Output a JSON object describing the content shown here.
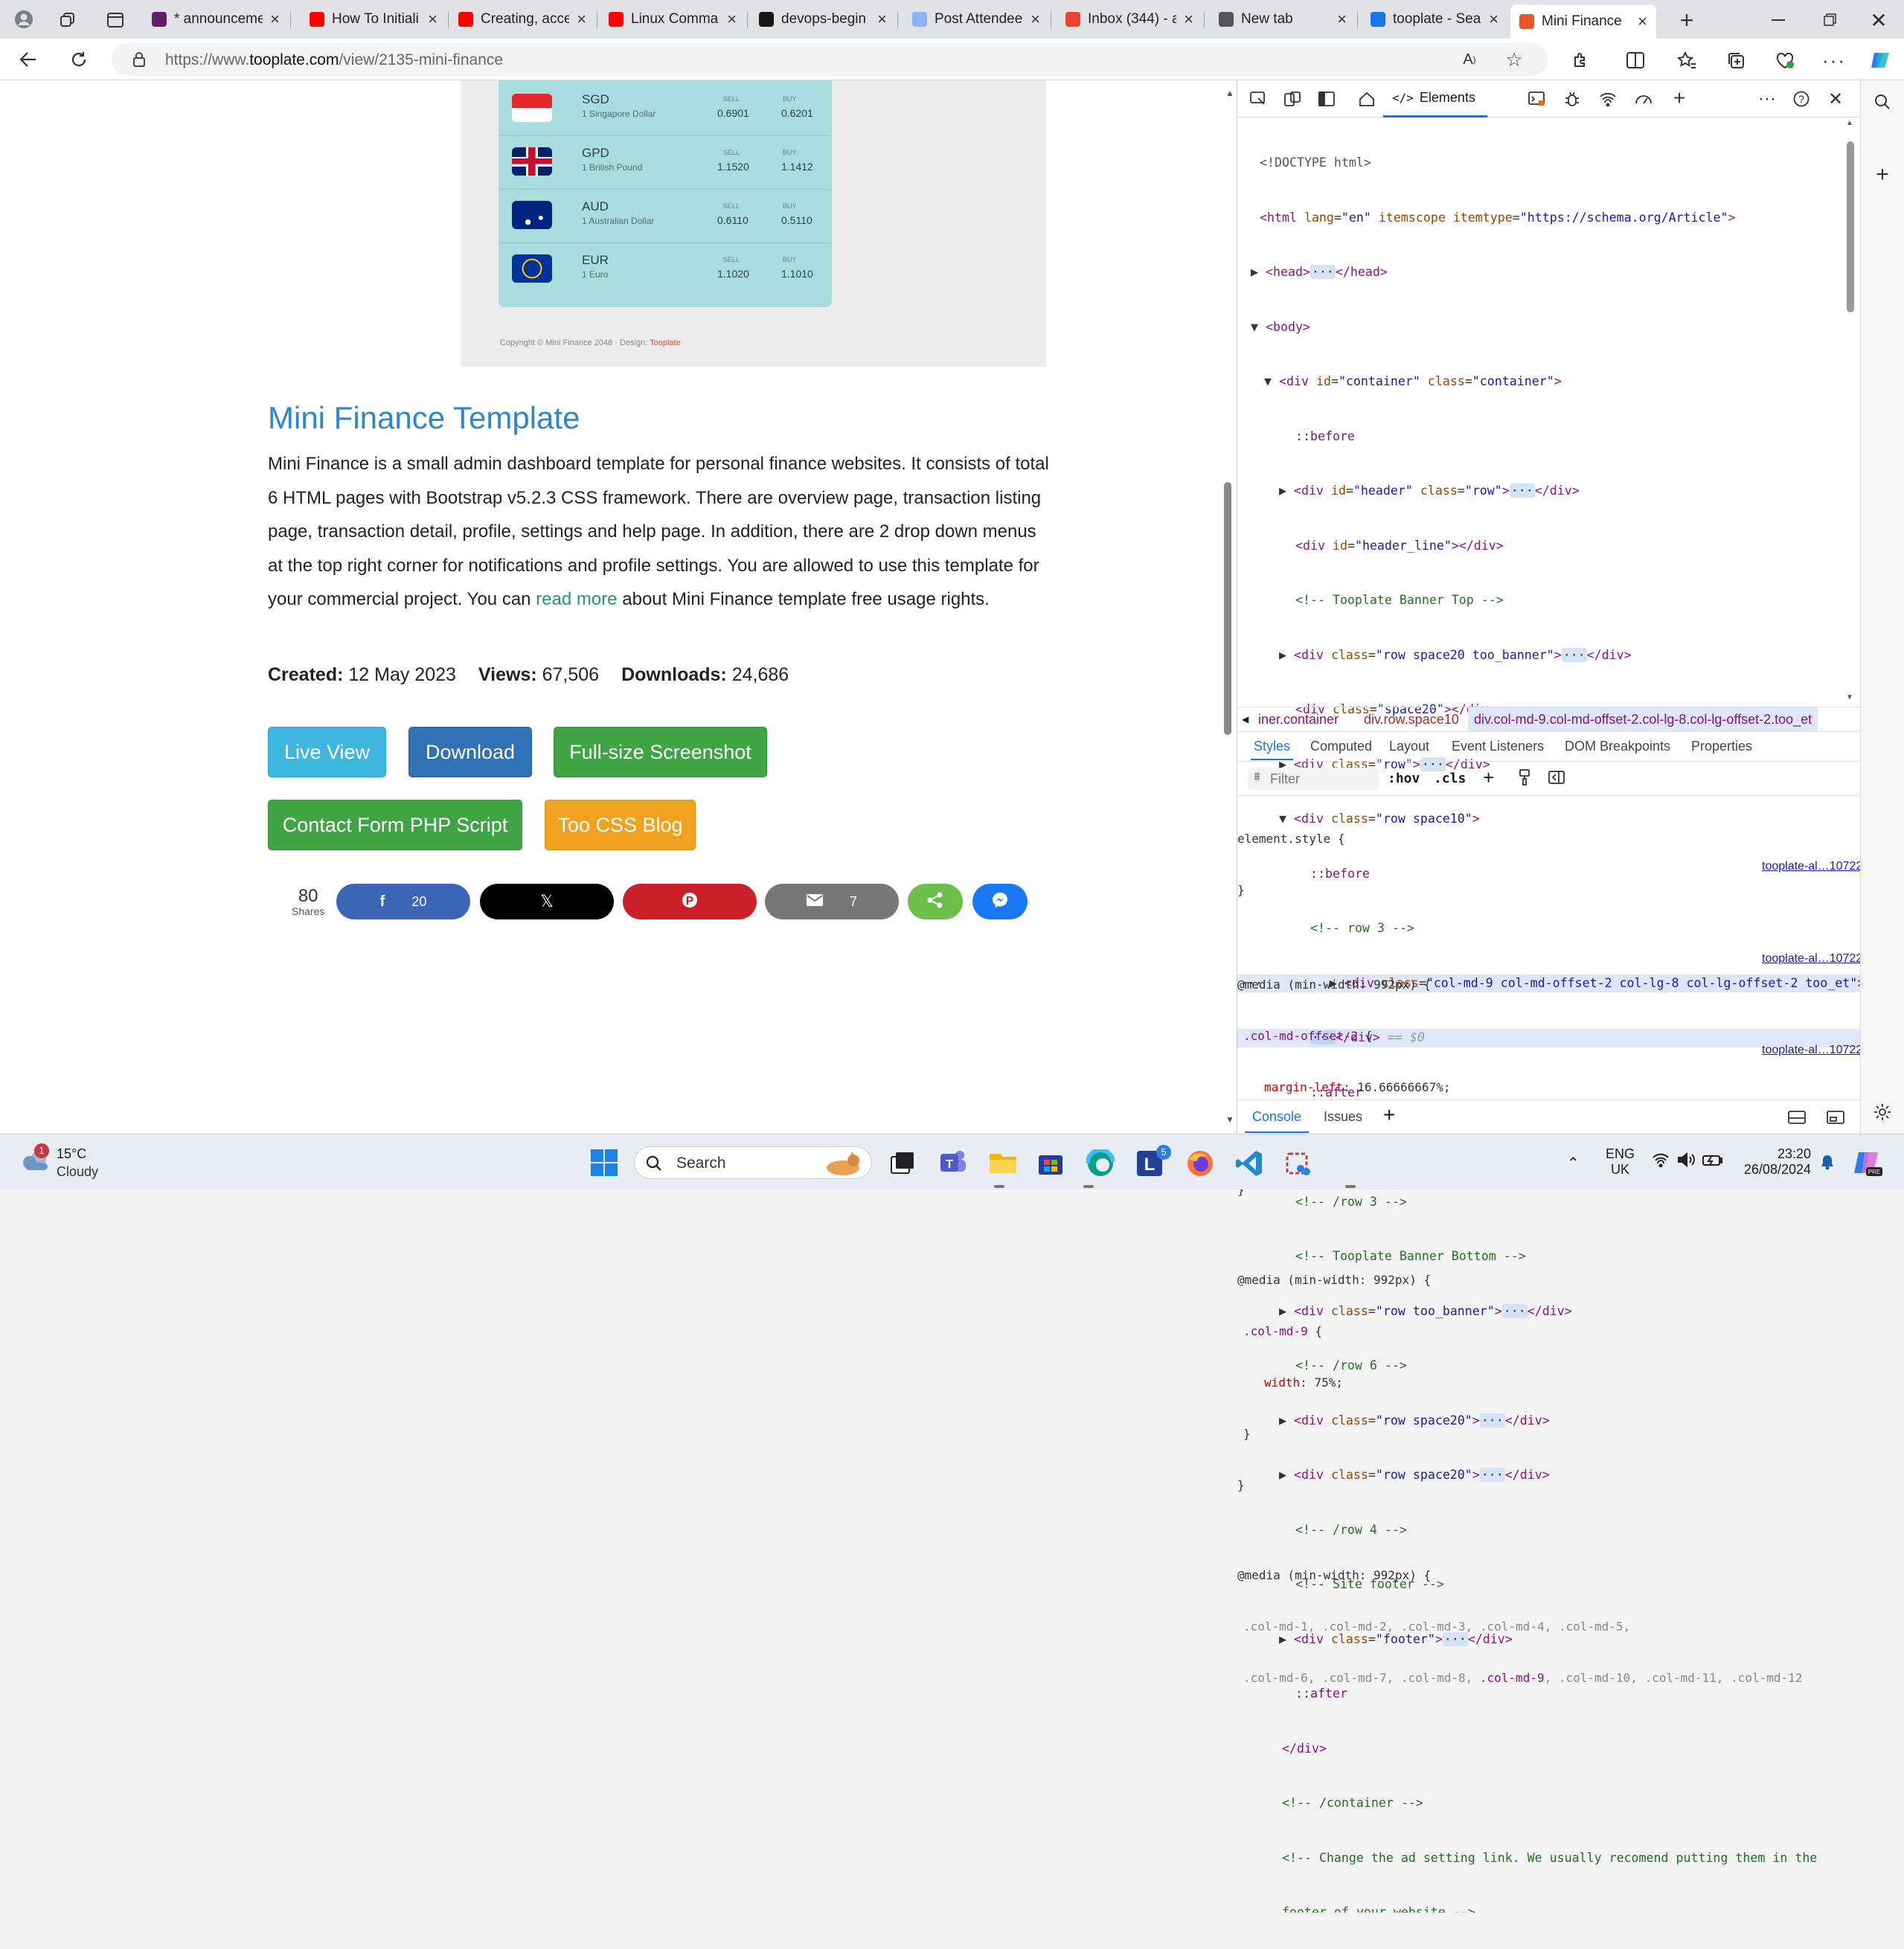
{
  "browser": {
    "tabs": [
      {
        "label": "* announceme",
        "icon": "slack-icon",
        "color": "#611f69"
      },
      {
        "label": "How To Initiali",
        "icon": "youtube-icon",
        "color": "#ff0000"
      },
      {
        "label": "Creating, acce",
        "icon": "youtube-icon",
        "color": "#ff0000"
      },
      {
        "label": "Linux Comma",
        "icon": "youtube-icon",
        "color": "#ff0000"
      },
      {
        "label": "devops-begin",
        "icon": "github-icon",
        "color": "#181717"
      },
      {
        "label": "Post Attendee",
        "icon": "zoom-icon",
        "color": "#8ab4f8"
      },
      {
        "label": "Inbox (344) - a",
        "icon": "gmail-icon",
        "color": "#ea4335"
      },
      {
        "label": "New tab",
        "icon": "newtab-icon",
        "color": "#555555"
      },
      {
        "label": "tooplate - Sea",
        "icon": "search-icon",
        "color": "#1a73e8"
      },
      {
        "label": "Mini Finance",
        "icon": "tooplate-icon",
        "color": "#e8562a"
      }
    ],
    "url_prefix": "https://www.",
    "url_domain": "tooplate.com",
    "url_path": "/view/2135-mini-finance"
  },
  "preview": {
    "currencies": [
      {
        "code": "SGD",
        "name": "1 Singapore Dollar",
        "sell": "0.6901",
        "buy": "0.6201"
      },
      {
        "code": "GPD",
        "name": "1 British Pound",
        "sell": "1.1520",
        "buy": "1.1412"
      },
      {
        "code": "AUD",
        "name": "1 Australian Dollar",
        "sell": "0.6110",
        "buy": "0.5110"
      },
      {
        "code": "EUR",
        "name": "1 Euro",
        "sell": "1.1020",
        "buy": "1.1010"
      }
    ],
    "sell_label": "SELL",
    "buy_label": "BUY",
    "copyright": "Copyright © Mini Finance 2048 · Design: ",
    "copyright_link": "Tooplate"
  },
  "article": {
    "title": "Mini Finance Template",
    "desc_before": "Mini Finance is a small admin dashboard template for personal finance websites. It consists of total 6 HTML pages with Bootstrap v5.2.3 CSS framework. There are overview page, transaction listing page, transaction detail, profile, settings and help page. In addition, there are 2 drop down menus at the top right corner for notifications and profile settings. You are allowed to use this template for your commercial project. You can ",
    "desc_link": "read more",
    "desc_after": " about Mini Finance template free usage rights.",
    "created_label": "Created:",
    "created": "12 May 2023",
    "views_label": "Views:",
    "views": "67,506",
    "downloads_label": "Downloads:",
    "downloads": "24,686",
    "buttons": {
      "live_view": "Live View",
      "download": "Download",
      "screenshot": "Full-size Screenshot",
      "contact": "Contact Form PHP Script",
      "blog": "Too CSS Blog"
    },
    "share_total": "80",
    "share_label": "Shares",
    "facebook_count": "20",
    "email_count": "7"
  },
  "devtools": {
    "panel": "Elements",
    "crumb_1": "iner.container",
    "crumb_2": "div.row.space10",
    "crumb_3": "div.col-md-9.col-md-offset-2.col-lg-8.col-lg-offset-2.too_et",
    "style_tabs": [
      "Styles",
      "Computed",
      "Layout",
      "Event Listeners",
      "DOM Breakpoints",
      "Properties"
    ],
    "filter_placeholder": "Filter",
    "hov": ":hov",
    "cls": ".cls",
    "source": "tooplate-al…10722.css:7",
    "console": "Console",
    "issues": "Issues"
  },
  "taskbar": {
    "temp": "15°C",
    "weather": "Cloudy",
    "weather_badge": "1",
    "search": "Search",
    "lang": "ENG",
    "region": "UK",
    "time": "23:20",
    "date": "26/08/2024",
    "app_badge": "5"
  }
}
